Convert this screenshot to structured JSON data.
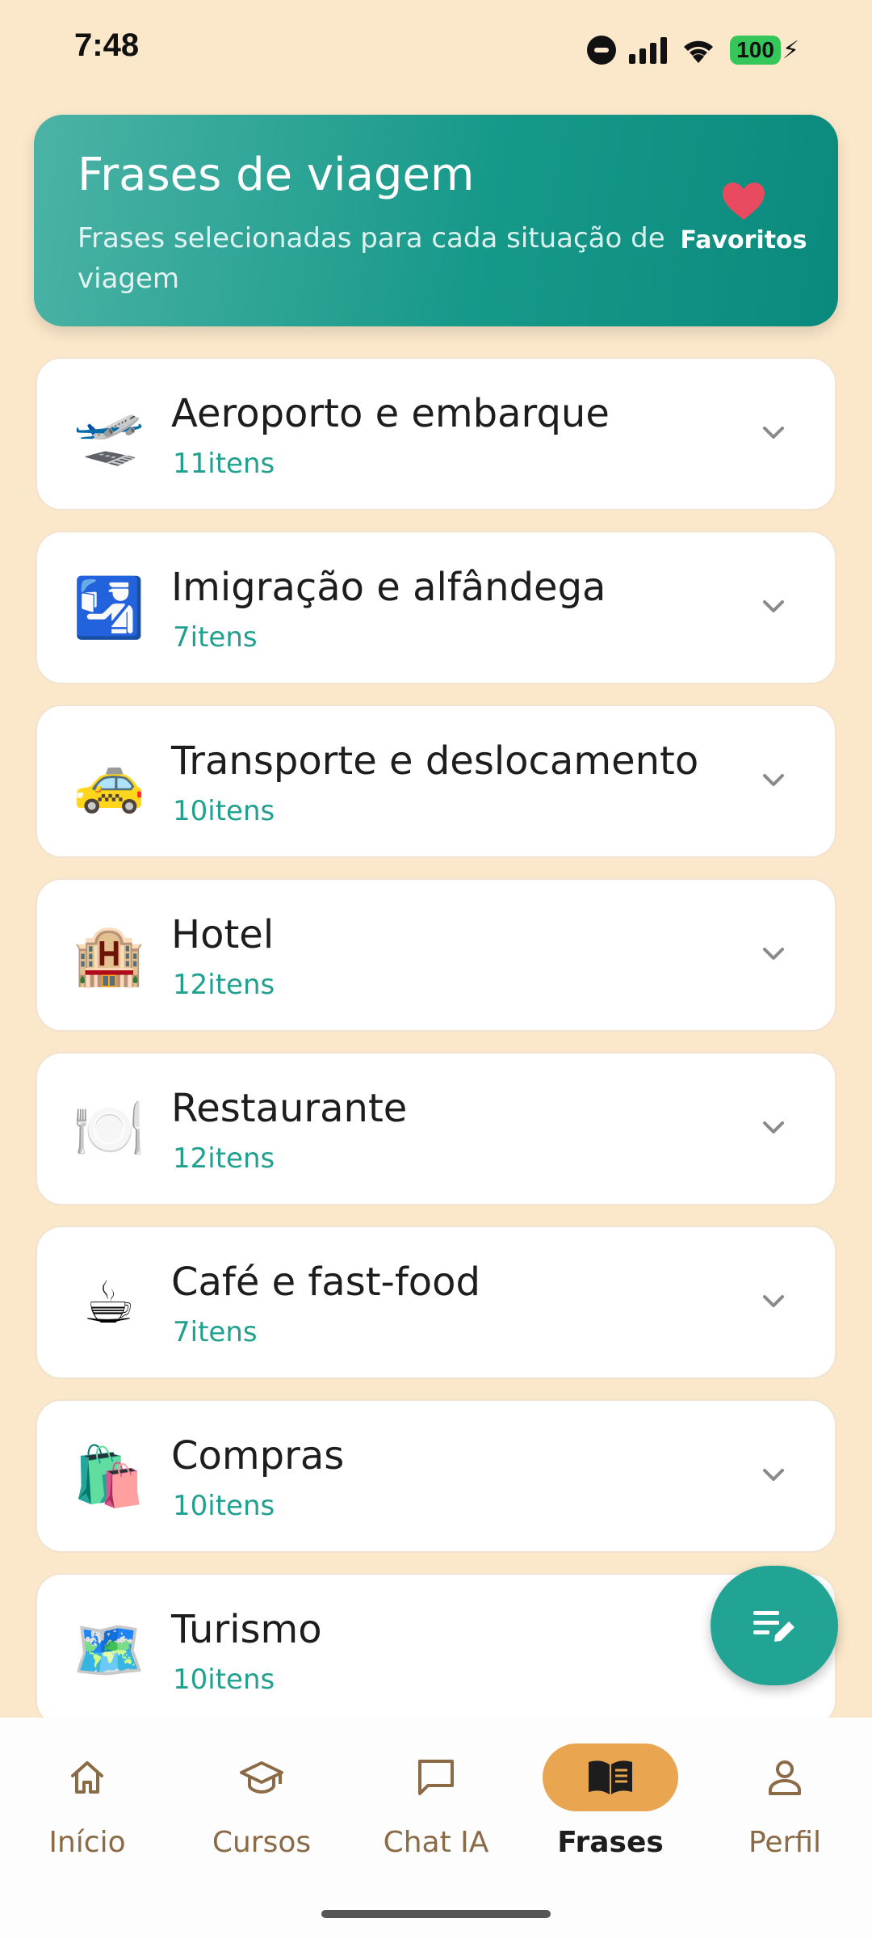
{
  "status_bar": {
    "time": "7:48",
    "battery": "100"
  },
  "header": {
    "title": "Frases de viagem",
    "subtitle": "Frases selecionadas para cada situação de viagem",
    "favorites_label": "Favoritos",
    "gradient_start": "#4bb3a6",
    "gradient_end": "#0a8a7c"
  },
  "categories": [
    {
      "icon": "airplane-icon",
      "emoji": "🛫",
      "title": "Aeroporto e embarque",
      "count": "11itens"
    },
    {
      "icon": "customs-officer-icon",
      "emoji": "🛂",
      "title": "Imigração e alfândega",
      "count": "7itens"
    },
    {
      "icon": "taxi-icon",
      "emoji": "🚕",
      "title": "Transporte e deslocamento",
      "count": "10itens"
    },
    {
      "icon": "hotel-icon",
      "emoji": "🏨",
      "title": "Hotel",
      "count": "12itens"
    },
    {
      "icon": "plate-cutlery-icon",
      "emoji": "🍽️",
      "title": "Restaurante",
      "count": "12itens"
    },
    {
      "icon": "coffee-icon",
      "emoji": "☕",
      "title": "Café e fast-food",
      "count": "7itens"
    },
    {
      "icon": "shopping-bags-icon",
      "emoji": "🛍️",
      "title": "Compras",
      "count": "10itens"
    },
    {
      "icon": "world-map-icon",
      "emoji": "🗺️",
      "title": "Turismo",
      "count": "10itens"
    }
  ],
  "nav": {
    "items": [
      {
        "label": "Início",
        "icon": "home-icon"
      },
      {
        "label": "Cursos",
        "icon": "graduation-cap-icon"
      },
      {
        "label": "Chat IA",
        "icon": "chat-bubble-icon"
      },
      {
        "label": "Frases",
        "icon": "book-icon"
      },
      {
        "label": "Perfil",
        "icon": "person-icon"
      }
    ],
    "active_color": "#e9a550",
    "inactive_text_color": "#8b6a46"
  },
  "colors": {
    "background": "#fbe7c9",
    "accent": "#21a08f",
    "fab": "#22a495"
  }
}
